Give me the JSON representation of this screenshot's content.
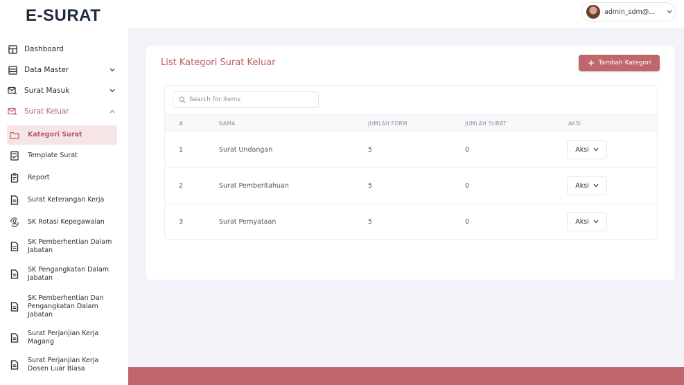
{
  "app": {
    "brand": "E-SURAT"
  },
  "user": {
    "name": "admin_sdm@..."
  },
  "sidebar": {
    "items": [
      {
        "label": "Dashboard",
        "icon": "dashboard-icon",
        "chevron": ""
      },
      {
        "label": "Data Master",
        "icon": "database-icon",
        "chevron": "down"
      },
      {
        "label": "Surat Masuk",
        "icon": "mail-in-icon",
        "chevron": "down"
      },
      {
        "label": "Surat Keluar",
        "icon": "mail-out-icon",
        "chevron": "up"
      }
    ],
    "sub_items": [
      {
        "label": "Kategori Surat",
        "icon": "folder-icon",
        "active": true
      },
      {
        "label": "Template Surat",
        "icon": "template-icon"
      },
      {
        "label": "Report",
        "icon": "report-icon"
      },
      {
        "label": "Surat Keterangan Kerja",
        "icon": "document-icon"
      },
      {
        "label": "SK Rotasi Kepegawaian",
        "icon": "rotate-user-icon"
      },
      {
        "label": "SK Pemberhentian Dalam Jabatan",
        "icon": "document-icon"
      },
      {
        "label": "SK Pengangkatan Dalam Jabatan",
        "icon": "document-icon"
      },
      {
        "label": "SK Pemberhentian Dan Pengangkatan Dalam Jabatan",
        "icon": "document-icon"
      },
      {
        "label": "Surat Perjanjian Kerja Magang",
        "icon": "document-icon"
      },
      {
        "label": "Surat Perjanjian Kerja Dosen Luar Biasa",
        "icon": "document-icon"
      }
    ]
  },
  "main": {
    "title": "List Kategori Surat Keluar",
    "add_button": "Tambah Kategori",
    "search_placeholder": "Search for items",
    "columns": [
      "#",
      "NAMA",
      "JUMLAH FORM",
      "JUMLAH SURAT",
      "AKSI"
    ],
    "rows": [
      {
        "no": "1",
        "nama": "Surat Undangan",
        "jumlah_form": "5",
        "jumlah_surat": "0",
        "aksi": "Aksi"
      },
      {
        "no": "2",
        "nama": "Surat Pemberitahuan",
        "jumlah_form": "5",
        "jumlah_surat": "0",
        "aksi": "Aksi"
      },
      {
        "no": "3",
        "nama": "Surat Pernyataan",
        "jumlah_form": "5",
        "jumlah_surat": "0",
        "aksi": "Aksi"
      }
    ]
  },
  "colors": {
    "accent": "#c0676d",
    "accent_text": "#b95c62",
    "active_bg": "#f5e5e6",
    "main_bg": "#f2f3f8"
  }
}
